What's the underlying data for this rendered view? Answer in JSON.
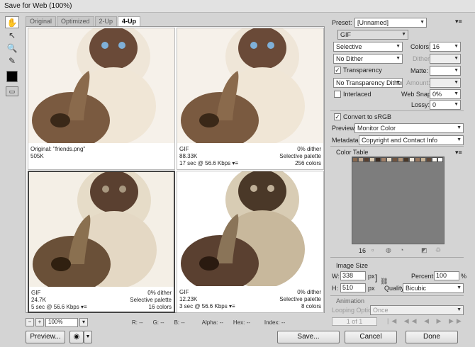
{
  "window": {
    "title": "Save for Web (100%)"
  },
  "tools": [
    {
      "icon": "hand-icon"
    },
    {
      "icon": "slice-select-icon"
    },
    {
      "icon": "zoom-icon"
    },
    {
      "icon": "eyedropper-icon"
    }
  ],
  "tabs": [
    "Original",
    "Optimized",
    "2-Up",
    "4-Up"
  ],
  "panes": [
    {
      "left_top": "Original: \"friends.png\"",
      "left_bottom": "505K",
      "right_top": "",
      "right_bottom": ""
    },
    {
      "left_top": "GIF",
      "left_bottom": "88.33K",
      "left_speed": "17 sec @ 56.6 Kbps",
      "right_top": "0% dither",
      "right_mid": "Selective palette",
      "right_bottom": "256 colors"
    },
    {
      "left_top": "GIF",
      "left_bottom": "24.7K",
      "left_speed": "5 sec @ 56.6 Kbps",
      "right_top": "0% dither",
      "right_mid": "Selective palette",
      "right_bottom": "16 colors"
    },
    {
      "left_top": "GIF",
      "left_bottom": "12.23K",
      "left_speed": "3 sec @ 56.6 Kbps",
      "right_top": "0% dither",
      "right_mid": "Selective palette",
      "right_bottom": "8 colors"
    }
  ],
  "bottombar": {
    "zoom": "100%",
    "r": "R: --",
    "g": "G: --",
    "b": "B: --",
    "alpha": "Alpha: --",
    "hex": "Hex: --",
    "index": "Index: --"
  },
  "buttons": {
    "preview": "Preview...",
    "save": "Save...",
    "cancel": "Cancel",
    "done": "Done"
  },
  "settings": {
    "preset_label": "Preset:",
    "preset_value": "[Unnamed]",
    "format": "GIF",
    "reduction": "Selective",
    "colors_label": "Colors:",
    "colors_value": "16",
    "dither": "No Dither",
    "dither_label": "Dither:",
    "transparency_label": "Transparency",
    "matte_label": "Matte:",
    "transparency_dither": "No Transparency Dither",
    "amount_label": "Amount:",
    "interlaced_label": "Interlaced",
    "websnap_label": "Web Snap:",
    "websnap_value": "0%",
    "lossy_label": "Lossy:",
    "lossy_value": "0",
    "convert_label": "Convert to sRGB",
    "preview_label": "Preview:",
    "preview_value": "Monitor Color",
    "metadata_label": "Metadata:",
    "metadata_value": "Copyright and Contact Info"
  },
  "color_table": {
    "label": "Color Table",
    "count": "16",
    "swatches": [
      "#8a6a50",
      "#c0a890",
      "#5a4030",
      "#d8c8b0",
      "#3a2a20",
      "#a08068",
      "#e8dcc8",
      "#705440",
      "#b09478",
      "#4a3828",
      "#f0e8dc",
      "#987860",
      "#c8b498",
      "#604838",
      "#fbf8f2",
      "#ffffff"
    ]
  },
  "image_size": {
    "label": "Image Size",
    "w_label": "W:",
    "w_value": "338",
    "h_label": "H:",
    "h_value": "510",
    "unit": "px",
    "percent_label": "Percent:",
    "percent_value": "100",
    "percent_unit": "%",
    "quality_label": "Quality:",
    "quality_value": "Bicubic"
  },
  "animation": {
    "label": "Animation",
    "looping_label": "Looping Options:",
    "looping_value": "Once",
    "frame": "1 of 1"
  }
}
